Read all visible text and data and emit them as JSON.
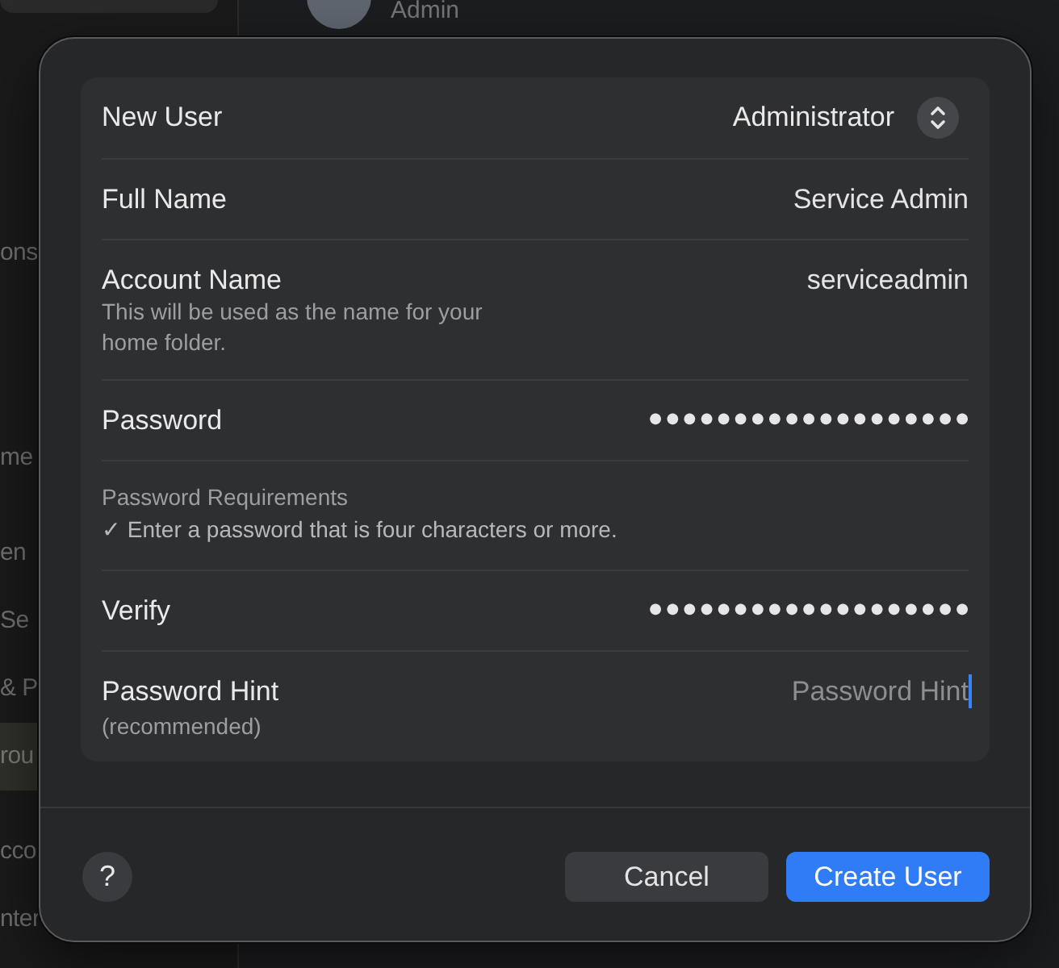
{
  "background": {
    "account": {
      "subtitle": "Admin"
    },
    "sidebar": {
      "items": [
        {
          "label": "ons",
          "selected": false
        },
        {
          "label": "me",
          "selected": false
        },
        {
          "label": "en",
          "selected": false
        },
        {
          "label": "Se",
          "selected": false
        },
        {
          "label": "& P",
          "selected": false
        },
        {
          "label": "rou",
          "selected": true
        },
        {
          "label": "cco",
          "selected": false
        },
        {
          "label": "nter",
          "selected": false
        }
      ]
    }
  },
  "dialog": {
    "rows": [
      {
        "kind": "popup",
        "label": "New User",
        "value": "Administrator"
      },
      {
        "kind": "text",
        "label": "Full Name",
        "value": "Service Admin"
      },
      {
        "kind": "text",
        "label": "Account Name",
        "description": "This will be used as the name for your home folder.",
        "value": "serviceadmin"
      },
      {
        "kind": "password",
        "label": "Password",
        "value": "●●●●●●●●●●●●●●●●●●●"
      },
      {
        "kind": "note",
        "title": "Password Requirements",
        "text": "✓ Enter a password that is four characters or more."
      },
      {
        "kind": "password",
        "label": "Verify",
        "value": "●●●●●●●●●●●●●●●●●●●"
      },
      {
        "kind": "text",
        "label": "Password Hint",
        "note": "(recommended)",
        "placeholder": "Password Hint",
        "focused": true
      }
    ],
    "help_button": "?",
    "buttons": [
      {
        "label": "Cancel",
        "kind": "secondary"
      },
      {
        "label": "Create User",
        "kind": "primary"
      }
    ]
  }
}
